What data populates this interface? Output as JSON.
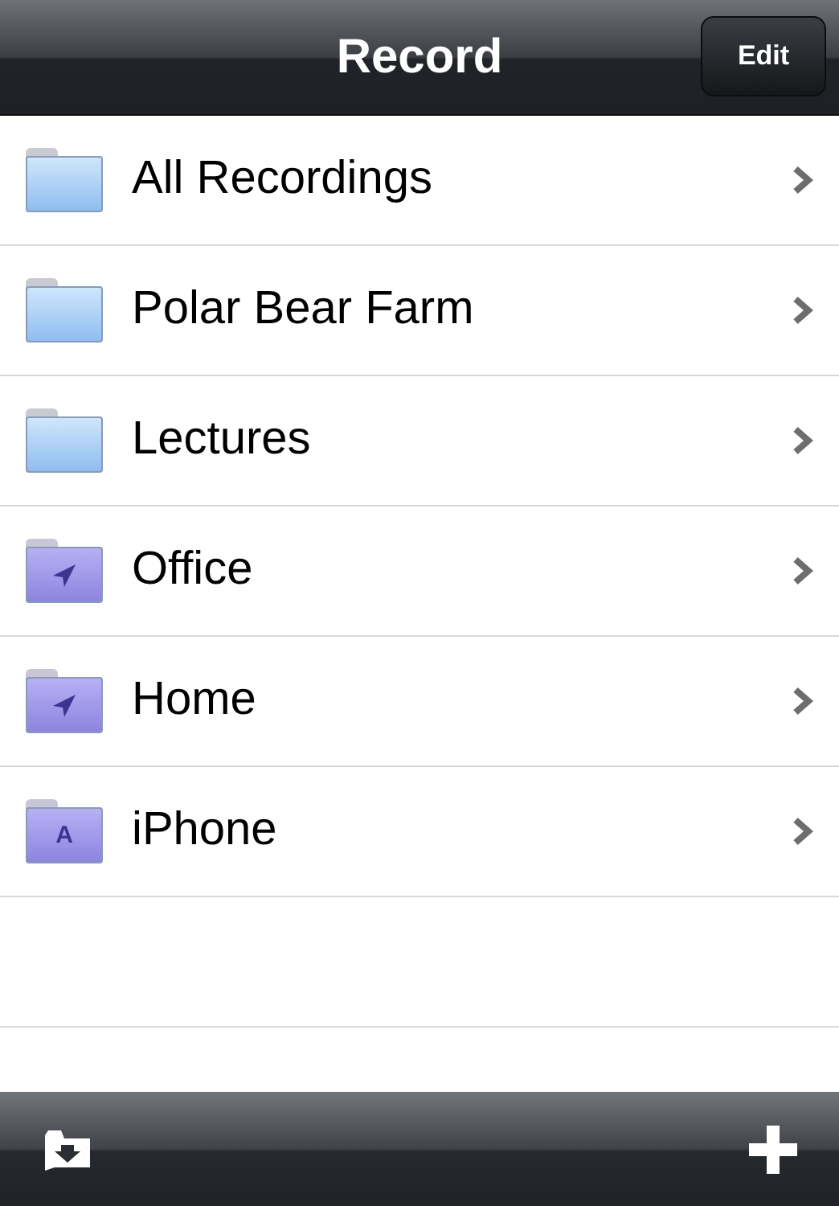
{
  "nav_bar": {
    "title": "Record",
    "edit_button": "Edit"
  },
  "folders": [
    {
      "kind": "plain",
      "label": "All Recordings"
    },
    {
      "kind": "plain",
      "label": "Polar Bear Farm"
    },
    {
      "kind": "plain",
      "label": "Lectures"
    },
    {
      "kind": "location",
      "label": "Office"
    },
    {
      "kind": "location",
      "label": "Home"
    },
    {
      "kind": "app",
      "label": "iPhone",
      "badge": "A"
    }
  ]
}
